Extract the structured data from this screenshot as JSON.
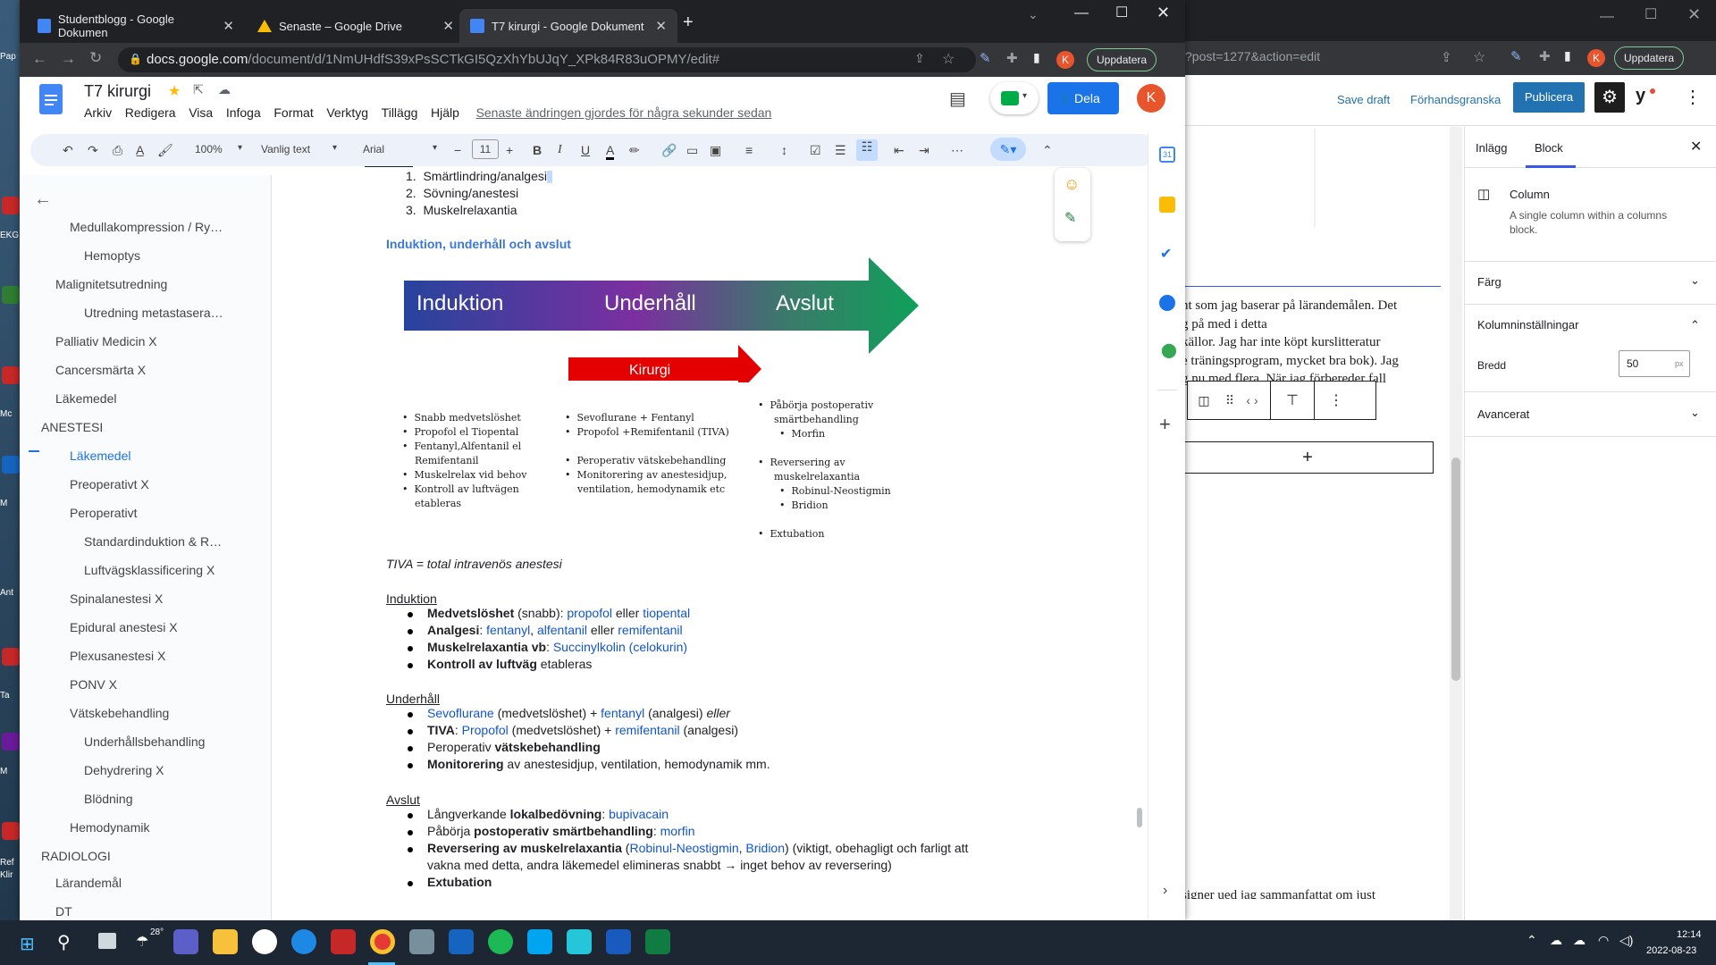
{
  "desktop": {
    "labels": [
      "Pap",
      "EKG",
      "Mc",
      "M",
      "Ant",
      "Ta",
      "M",
      "Ref",
      "Klir"
    ]
  },
  "browser_tabs": [
    {
      "title": "Studentblogg - Google Dokumen"
    },
    {
      "title": "Senaste – Google Drive"
    },
    {
      "title": "T7 kirurgi - Google Dokument"
    }
  ],
  "address": {
    "host": "docs.google.com",
    "path": "/document/d/1NmUHdfS39xPsSCTkGI5QzXhYbUJqY_XPk84R83uOPMY/edit#"
  },
  "update_label": "Uppdatera",
  "avatar_letter": "K",
  "doc": {
    "title": "T7 kirurgi",
    "menu": [
      "Arkiv",
      "Redigera",
      "Visa",
      "Infoga",
      "Format",
      "Verktyg",
      "Tillägg",
      "Hjälp"
    ],
    "last_edit": "Senaste ändringen gjordes för några sekunder sedan",
    "share_label": "Dela"
  },
  "toolbar": {
    "zoom": "100%",
    "style": "Vanlig text",
    "font": "Arial",
    "size": "11"
  },
  "outline": [
    {
      "text": "Medullakompression / Ry…",
      "level": 2
    },
    {
      "text": "Hemoptys",
      "level": 3
    },
    {
      "text": "Malignitetsutredning",
      "level": 1
    },
    {
      "text": "Utredning metastasera…",
      "level": 3
    },
    {
      "text": "Palliativ Medicin X",
      "level": 1
    },
    {
      "text": "Cancersmärta X",
      "level": 1
    },
    {
      "text": "Läkemedel",
      "level": 1
    },
    {
      "text": "ANESTESI",
      "level": 0
    },
    {
      "text": "Läkemedel",
      "level": 2,
      "active": true
    },
    {
      "text": "Preoperativt X",
      "level": 2
    },
    {
      "text": "Peroperativt",
      "level": 2
    },
    {
      "text": "Standardinduktion & R…",
      "level": 3
    },
    {
      "text": "Luftvägsklassificering X",
      "level": 3
    },
    {
      "text": "Spinalanestesi X",
      "level": 2
    },
    {
      "text": "Epidural anestesi X",
      "level": 2
    },
    {
      "text": "Plexusanestesi X",
      "level": 2
    },
    {
      "text": "PONV X",
      "level": 2
    },
    {
      "text": "Vätskebehandling",
      "level": 2
    },
    {
      "text": "Underhållsbehandling",
      "level": 3
    },
    {
      "text": "Dehydrering X",
      "level": 3
    },
    {
      "text": "Blödning",
      "level": 3
    },
    {
      "text": "Hemodynamik",
      "level": 2
    },
    {
      "text": "RADIOLOGI",
      "level": 0
    },
    {
      "text": "Lärandemål",
      "level": 1
    },
    {
      "text": "DT",
      "level": 1
    }
  ],
  "content": {
    "numbered": [
      "Smärtlindring/analgesi",
      "Sövning/anestesi",
      "Muskelrelaxantia"
    ],
    "heading": "Induktion, underhåll och avslut",
    "diagram": {
      "arrow_labels": [
        "Induktion",
        "Underhåll",
        "Avslut"
      ],
      "kirurgi": "Kirurgi",
      "col1": [
        "Snabb medvetslöshet",
        "Propofol el Tiopental",
        "Fentanyl,Alfentanil el",
        "Remifentanil",
        "Muskelrelax vid behov",
        "Kontroll av luftvägen",
        "etableras"
      ],
      "col2": [
        "Sevoflurane + Fentanyl",
        "Propofol +Remifentanil (TIVA)",
        "Peroperativ vätskebehandling",
        "Monitorering av anestesidjup,",
        "ventilation, hemodynamik etc"
      ],
      "col3": [
        "Påbörja postoperativ",
        "smärtbehandling",
        "Morfin",
        "Reversering av",
        "muskelrelaxantia",
        "Robinul-Neostigmin",
        "Bridion",
        "Extubation"
      ]
    },
    "tiva_note": "TIVA = total intravenös anestesi",
    "induktion_heading": "Induktion",
    "induktion": [
      {
        "b": "Medvetslöshet",
        "t": " (snabb): ",
        "links": [
          "propofol",
          " eller ",
          "tiopental"
        ]
      },
      {
        "b": "Analgesi",
        "t": ": ",
        "links": [
          "fentanyl",
          ", ",
          "alfentanil",
          " eller ",
          "remifentanil"
        ]
      },
      {
        "b": "Muskelrelaxantia vb",
        "t": ": ",
        "links": [
          "Succinylkolin",
          " (",
          "celokurin",
          ")"
        ]
      },
      {
        "b": "Kontroll av luftväg",
        "t": " etableras",
        "links": []
      }
    ],
    "underhall_heading": "Underhåll",
    "underhall": [
      {
        "pre": "",
        "l1": "Sevoflurane",
        "m": " (medvetslöshet) + ",
        "l2": "fentanyl",
        "post": " (analgesi) ",
        "i": "eller"
      },
      {
        "pre": "TIVA",
        "p2": ": ",
        "l1": "Propofol",
        "m": " (medvetslöshet) + ",
        "l2": "remifentanil",
        "post": " (analgesi)",
        "i": ""
      },
      {
        "plain": "Peroperativ ",
        "b": "vätskebehandling"
      },
      {
        "b2": "Monitorering",
        "plain2": " av anestesidjup, ventilation, hemodynamik mm."
      }
    ],
    "avslut_heading": "Avslut",
    "avslut": [
      {
        "plain": "Långverkande ",
        "b": "lokalbedövning",
        "sep": ": ",
        "l": "bupivacain"
      },
      {
        "plain": "Påbörja ",
        "b": "postoperativ smärtbehandling",
        "sep": ": ",
        "l": "morfin"
      },
      {
        "b": "Reversering av muskelrelaxantia",
        "sep": " (",
        "l": "Robinul-Neostigmin",
        "sep2": ", ",
        "l2": "Bridion",
        "rest": ") (viktigt, obehagligt och farligt att",
        "line2": "vakna med detta, andra läkemedel elimineras snabbt → inget behov av reversering)"
      },
      {
        "b": "Extubation"
      }
    ]
  },
  "wp": {
    "address": "?post=1277&action=edit",
    "save_draft": "Save draft",
    "preview": "Förhandsgranska",
    "publish": "Publicera",
    "tabs": [
      "Inlägg",
      "Block"
    ],
    "block_name": "Column",
    "block_desc_1": "A single column within a columns",
    "block_desc_2": "block.",
    "panel_color": "Färg",
    "panel_column": "Kolumninställningar",
    "width_label": "Bredd",
    "width_value": "50",
    "width_unit": "px",
    "panel_advanced": "Avancerat",
    "text_lines": [
      "nt som jag baserar på lärandemålen. Det",
      "g på med i detta",
      "källor. Jag har inte köpt kurslitteratur",
      "e träningsprogram, mycket bra bok). Jag",
      "g nu med flera. När jag förbereder fall"
    ],
    "bottom_text": "signer ued jag sammanfattat om just"
  },
  "taskbar": {
    "temp": "28°",
    "time": "12:14",
    "date": "2022-08-23"
  }
}
